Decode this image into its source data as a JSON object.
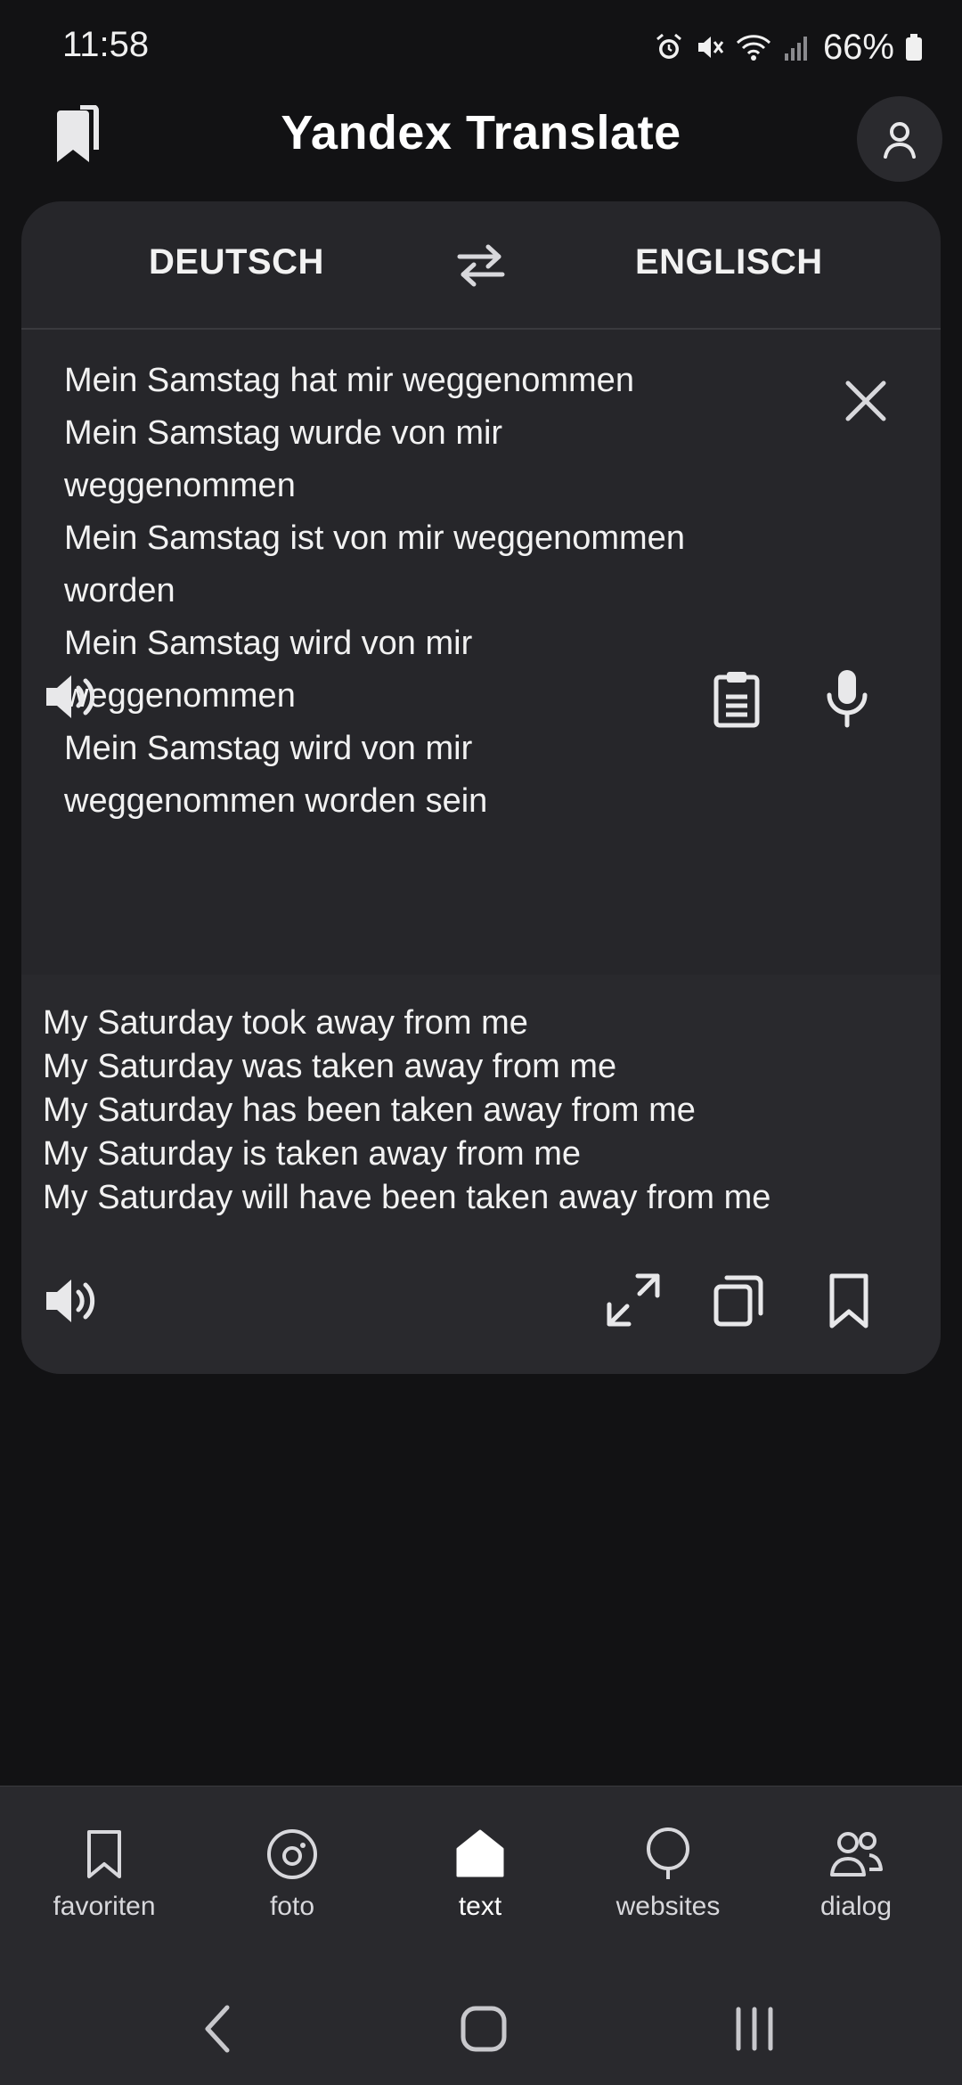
{
  "status_bar": {
    "time": "11:58",
    "battery": "66%"
  },
  "header": {
    "title": "Yandex Translate"
  },
  "languages": {
    "source": "DEUTSCH",
    "target": "ENGLISCH"
  },
  "source_text": [
    "Mein Samstag hat mir weggenommen",
    "Mein Samstag wurde von mir",
    "weggenommen",
    "Mein Samstag ist von mir weggenommen",
    "worden",
    "Mein Samstag wird von mir",
    "weggenommen",
    "Mein Samstag wird von mir",
    "weggenommen worden sein"
  ],
  "translation_text": [
    "My Saturday took away from me",
    "My Saturday was taken away from me",
    "My Saturday has been taken away from me",
    "My Saturday is taken away from me",
    "My Saturday will have been taken away from me"
  ],
  "bottom_nav": {
    "items": [
      {
        "label": "favoriten",
        "icon": "bookmark-icon"
      },
      {
        "label": "foto",
        "icon": "camera-icon"
      },
      {
        "label": "text",
        "icon": "home-icon"
      },
      {
        "label": "websites",
        "icon": "globe-icon"
      },
      {
        "label": "dialog",
        "icon": "people-icon"
      }
    ],
    "active": "text"
  },
  "colors": {
    "background": "#121214",
    "card": "#26262a",
    "text": "#f2f2f2"
  }
}
